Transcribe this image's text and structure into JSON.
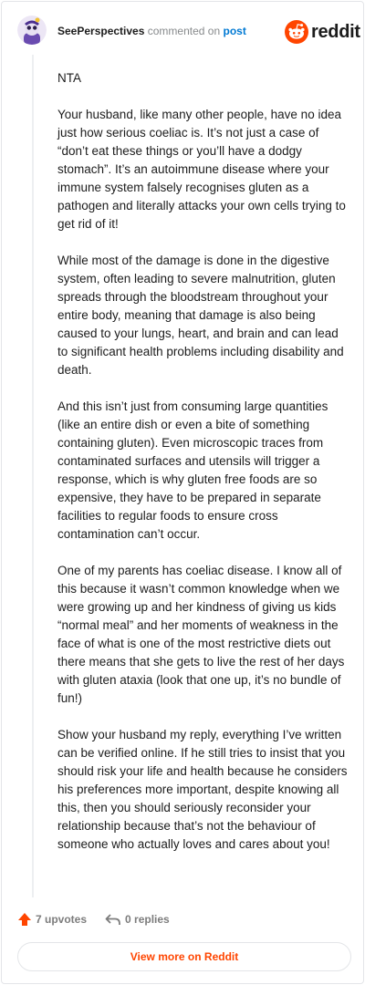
{
  "comment": {
    "username": "SeePerspectives",
    "action_text": "commented on",
    "post_link": "post",
    "paragraphs": [
      "NTA",
      "Your husband, like many other people, have no idea just how serious coeliac is. It’s not just a case of “don’t eat these things or you’ll have a dodgy stomach”. It’s an autoimmune disease where your immune system falsely recognises gluten as a pathogen and literally attacks your own cells trying to get rid of it!",
      "While most of the damage is done in the digestive system, often leading to severe malnutrition, gluten spreads through the bloodstream throughout your entire body, meaning that damage is also being caused to your lungs, heart, and brain and can lead to significant health problems including disability and death.",
      "And this isn’t just from consuming large quantities (like an entire dish or even a bite of something containing gluten). Even microscopic traces from contaminated surfaces and utensils will trigger a response, which is why gluten free foods are so expensive, they have to be prepared in separate facilities to regular foods to ensure cross contamination can’t occur.",
      "One of my parents has coeliac disease. I know all of this because it wasn’t common knowledge when we were growing up and her kindness of giving us kids “normal meal” and her moments of weakness in the face of what is one of the most restrictive diets out there means that she gets to live the rest of her days with gluten ataxia (look that one up, it’s no bundle of fun!)",
      "Show your husband my reply, everything I’ve written can be verified online. If he still tries to insist that you should risk your life and health because he considers his preferences more important, despite knowing all this, then you should seriously reconsider your relationship because that’s not the behaviour of someone who actually loves and cares about you!"
    ],
    "upvotes": "7 upvotes",
    "replies": "0 replies"
  },
  "brand": {
    "logo_text": "reddit",
    "color": "#ff4500"
  },
  "view_more_label": "View more on Reddit",
  "icons": {
    "upvote": "upvote-arrow-icon",
    "reply": "reply-arrow-icon",
    "logo": "reddit-snoo-icon"
  }
}
